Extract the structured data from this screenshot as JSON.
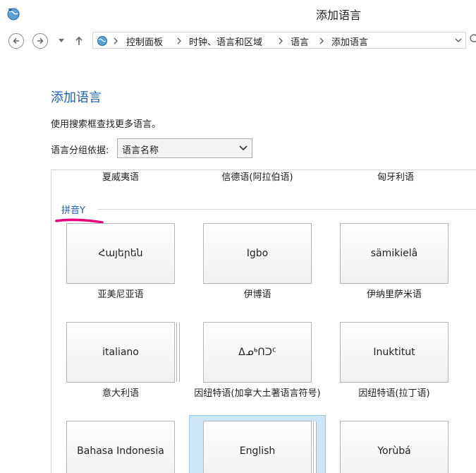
{
  "window": {
    "title": "添加语言"
  },
  "breadcrumbs": [
    "控制面板",
    "时钟、语言和区域",
    "语言",
    "添加语言"
  ],
  "page": {
    "heading": "添加语言",
    "description": "使用搜索框查找更多语言。",
    "group_label": "语言分组依据:",
    "group_value": "语言名称"
  },
  "previous_row": [
    "夏威夷语",
    "信德语(阿拉伯语)",
    "匈牙利语"
  ],
  "section": {
    "label": "拼音Y"
  },
  "tiles": [
    {
      "native": "Հայերեն",
      "name": "亚美尼亚语"
    },
    {
      "native": "Igbo",
      "name": "伊博语"
    },
    {
      "native": "sämikielâ",
      "name": "伊纳里萨米语"
    },
    {
      "native": "italiano",
      "name": "意大利语"
    },
    {
      "native": "ᐃᓄᒃᑎᑐᑦ",
      "name": "因纽特语(加拿大土著语言符号)"
    },
    {
      "native": "Inuktitut",
      "name": "因纽特语(拉丁语)"
    },
    {
      "native": "Bahasa Indonesia",
      "name": ""
    },
    {
      "native": "English",
      "name": ""
    },
    {
      "native": "Yorùbá",
      "name": ""
    }
  ],
  "icons": {
    "app": "language-globe-icon",
    "back": "back-arrow-icon",
    "forward": "forward-arrow-icon",
    "recent": "recent-locations-chevron-icon",
    "up": "up-arrow-icon",
    "location": "control-panel-language-icon",
    "dropdown": "chevron-down-icon",
    "refresh": "refresh-icon"
  },
  "colors": {
    "accent": "#1d5fb0",
    "highlight": "#cde6f7",
    "marker": "#e6007e"
  }
}
